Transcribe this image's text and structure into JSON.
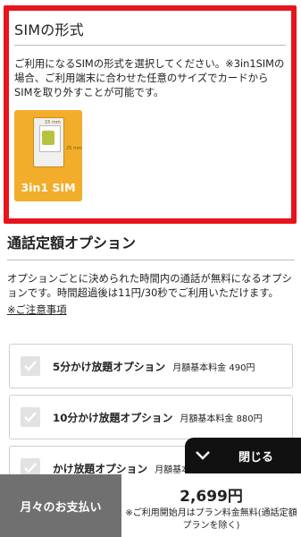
{
  "sim_section": {
    "title": "SIMの形式",
    "description": "ご利用になるSIMの形式を選択してください。※3in1SIMの場合、ご利用端末に合わせた任意のサイズでカードからSIMを取り外すことが可能です。",
    "card_label": "3in1 SIM",
    "card_dim_width": "15 mm",
    "card_dim_height": "25 mm",
    "highlight_color": "#e8141b",
    "card_color": "#f2ad2a"
  },
  "call_section": {
    "title": "通話定額オプション",
    "description": "オプションごとに決められた時間内の通話が無料になるオプションです。時間超過後は11円/30秒でご利用いただけます。",
    "note_link": "※ご注意事項"
  },
  "options": [
    {
      "name": "5分かけ放題オプション",
      "price": "月額基本料金 490円",
      "checked": false
    },
    {
      "name": "10分かけ放題オプション",
      "price": "月額基本料金 880円",
      "checked": false
    },
    {
      "name": "かけ放題オプション",
      "price": "月額基本料金",
      "checked": false
    }
  ],
  "close_button": {
    "label": "閉じる",
    "icon": "chevron-down-icon"
  },
  "payment_bar": {
    "label": "月々のお支払い",
    "amount": "2,699円",
    "note": "※ご利用開始月はプラン料金無料(通話定額プランを除く)"
  }
}
